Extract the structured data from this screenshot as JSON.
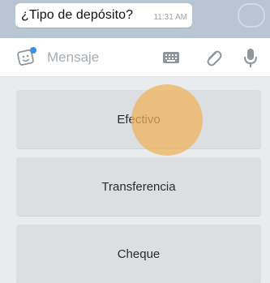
{
  "chat": {
    "message_text": "¿Tipo de depósito?",
    "message_time": "11:31 AM"
  },
  "input_bar": {
    "placeholder": "Mensaje",
    "icons": [
      "sticker-icon",
      "keyboard-icon",
      "paperclip-icon",
      "microphone-icon"
    ]
  },
  "reply_keyboard": {
    "buttons": [
      "Efectivo",
      "Transferencia",
      "Cheque"
    ]
  },
  "colors": {
    "chat_background": "#b7c6d2",
    "button_background": "#dcdfe2",
    "touch_indicator": "#eeb258"
  }
}
